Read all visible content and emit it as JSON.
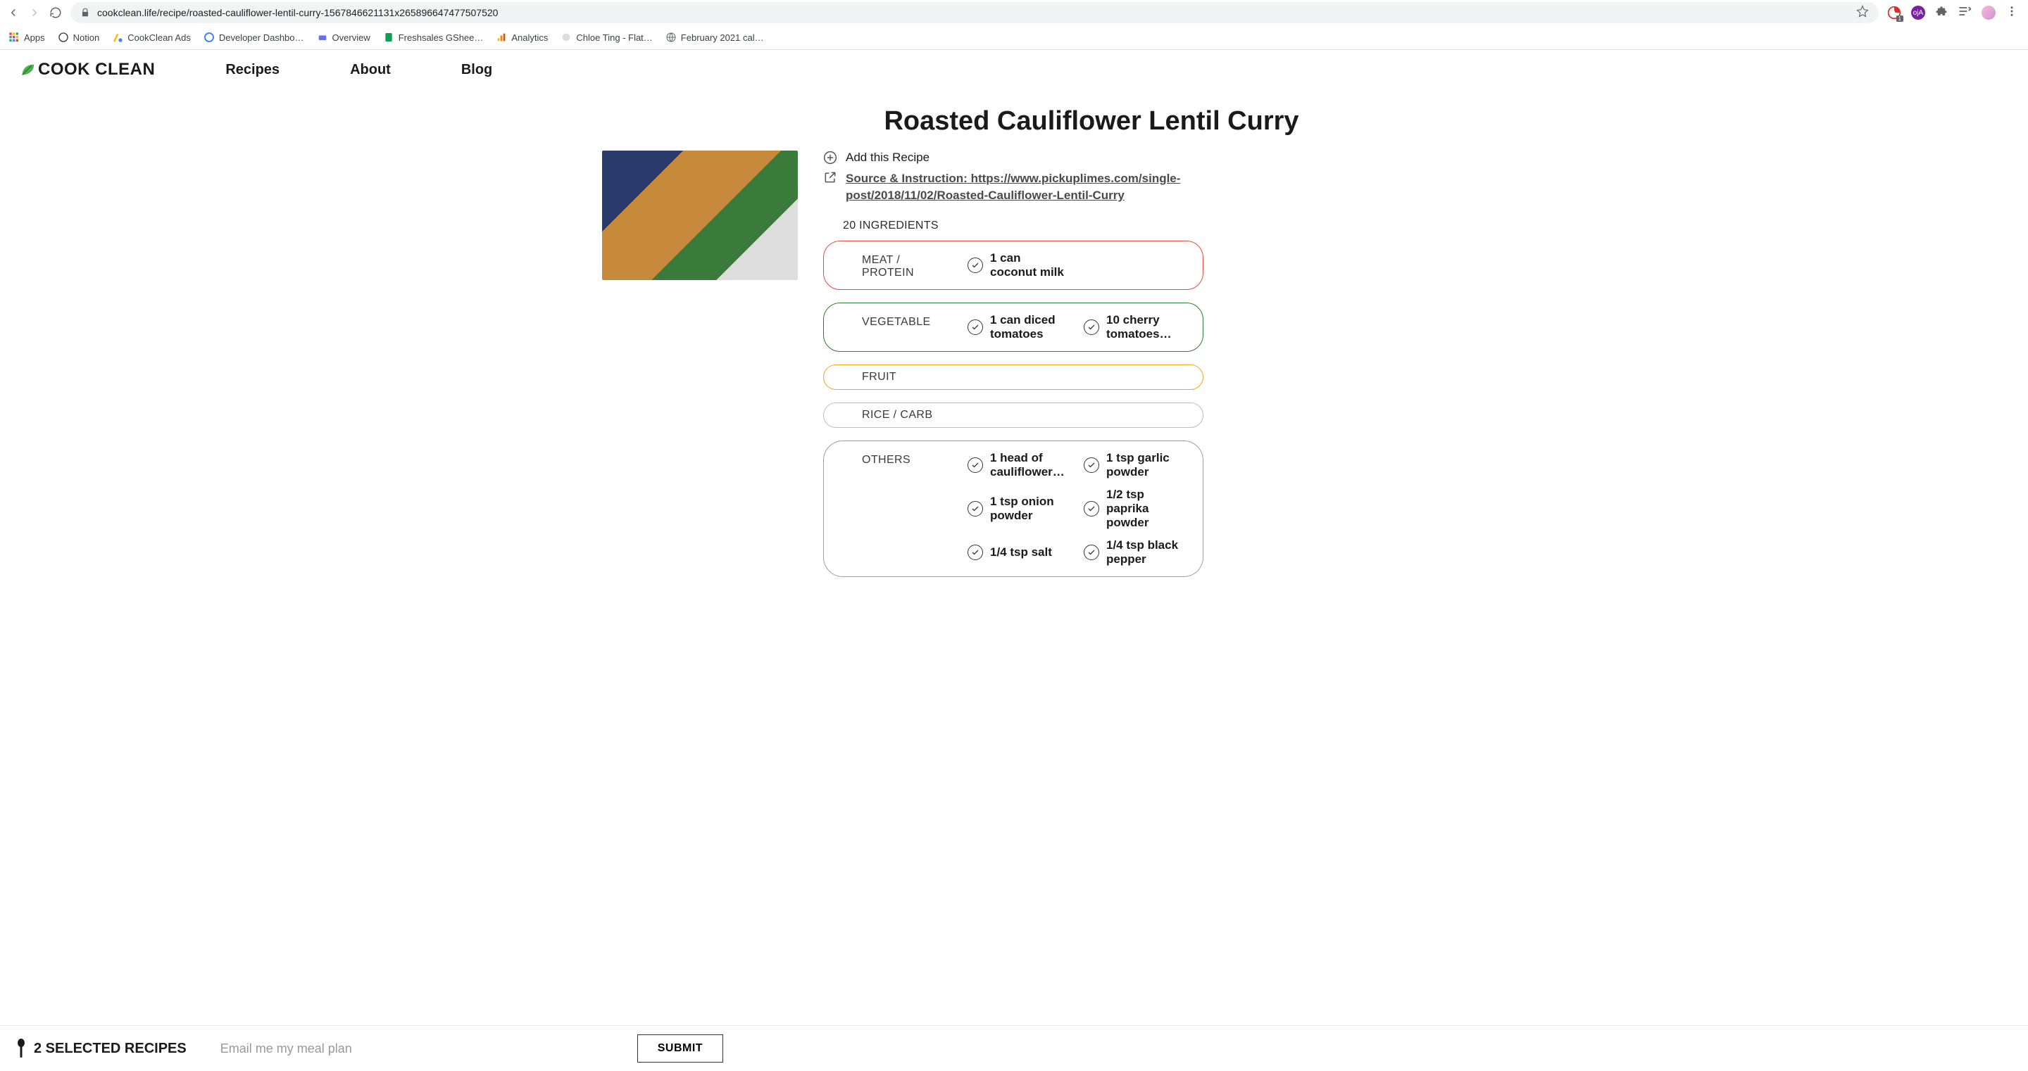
{
  "browser": {
    "url": "cookclean.life/recipe/roasted-cauliflower-lentil-curry-1567846621131x265896647477507520"
  },
  "bookmarks": [
    {
      "label": "Apps"
    },
    {
      "label": "Notion"
    },
    {
      "label": "CookClean Ads"
    },
    {
      "label": "Developer Dashbo…"
    },
    {
      "label": "Overview"
    },
    {
      "label": "Freshsales GShee…"
    },
    {
      "label": "Analytics"
    },
    {
      "label": "Chloe Ting - Flat…"
    },
    {
      "label": "February 2021 cal…"
    }
  ],
  "site": {
    "logo": "COOK CLEAN",
    "nav": {
      "recipes": "Recipes",
      "about": "About",
      "blog": "Blog"
    }
  },
  "recipe": {
    "title": "Roasted Cauliflower Lentil Curry",
    "add_label": "Add this Recipe",
    "source_label": "Source & Instruction: https://www.pickuplimes.com/single-post/2018/11/02/Roasted-Cauliflower-Lentil-Curry",
    "ingredients_header": "20 INGREDIENTS",
    "categories": [
      {
        "key": "meat",
        "label": "MEAT / PROTEIN",
        "items": [
          "1 can coconut milk"
        ]
      },
      {
        "key": "vegetable",
        "label": "VEGETABLE",
        "items": [
          "1 can diced tomatoes",
          "10  cherry tomatoes…"
        ]
      },
      {
        "key": "fruit",
        "label": "FRUIT",
        "items": []
      },
      {
        "key": "rice",
        "label": "RICE / CARB",
        "items": []
      },
      {
        "key": "others",
        "label": "OTHERS",
        "items": [
          "1  head of cauliflower…",
          "1 tsp garlic powder",
          "1 tsp onion powder",
          "1/2 tsp paprika powder",
          "1/4 tsp salt",
          "1/4 tsp black pepper"
        ]
      }
    ]
  },
  "footer": {
    "selected_label": "2 SELECTED RECIPES",
    "email_placeholder": "Email me my meal plan",
    "submit_label": "SUBMIT"
  }
}
